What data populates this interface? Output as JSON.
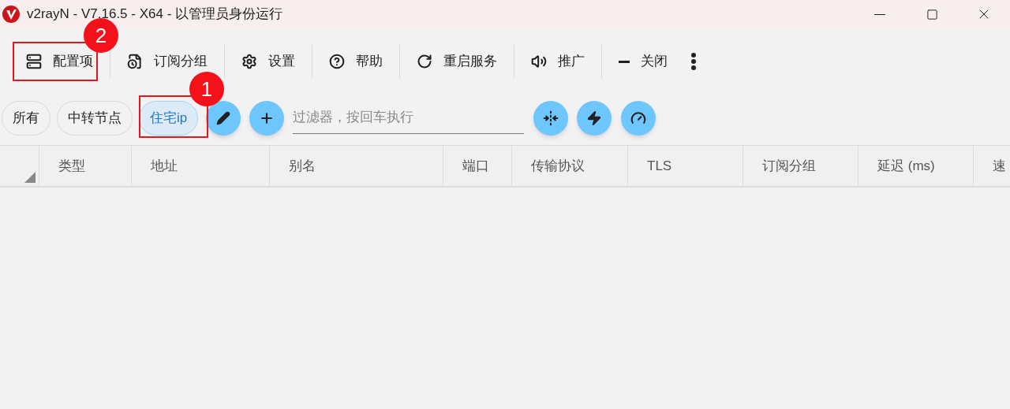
{
  "window": {
    "title": "v2rayN - V7.16.5 - X64 - 以管理员身份运行"
  },
  "toolbar": [
    {
      "label": "配置项"
    },
    {
      "label": "订阅分组"
    },
    {
      "label": "设置"
    },
    {
      "label": "帮助"
    },
    {
      "label": "重启服务"
    },
    {
      "label": "推广"
    },
    {
      "label": "关闭"
    }
  ],
  "groups": [
    {
      "label": "所有",
      "selected": false
    },
    {
      "label": "中转节点",
      "selected": false
    },
    {
      "label": "住宅ip",
      "selected": true
    }
  ],
  "filter": {
    "placeholder": "过滤器，按回车执行"
  },
  "table": {
    "columns": [
      "类型",
      "地址",
      "别名",
      "端口",
      "传输协议",
      "TLS",
      "订阅分组",
      "延迟 (ms)",
      "速"
    ]
  },
  "annotations": [
    {
      "number": "1"
    },
    {
      "number": "2"
    }
  ]
}
